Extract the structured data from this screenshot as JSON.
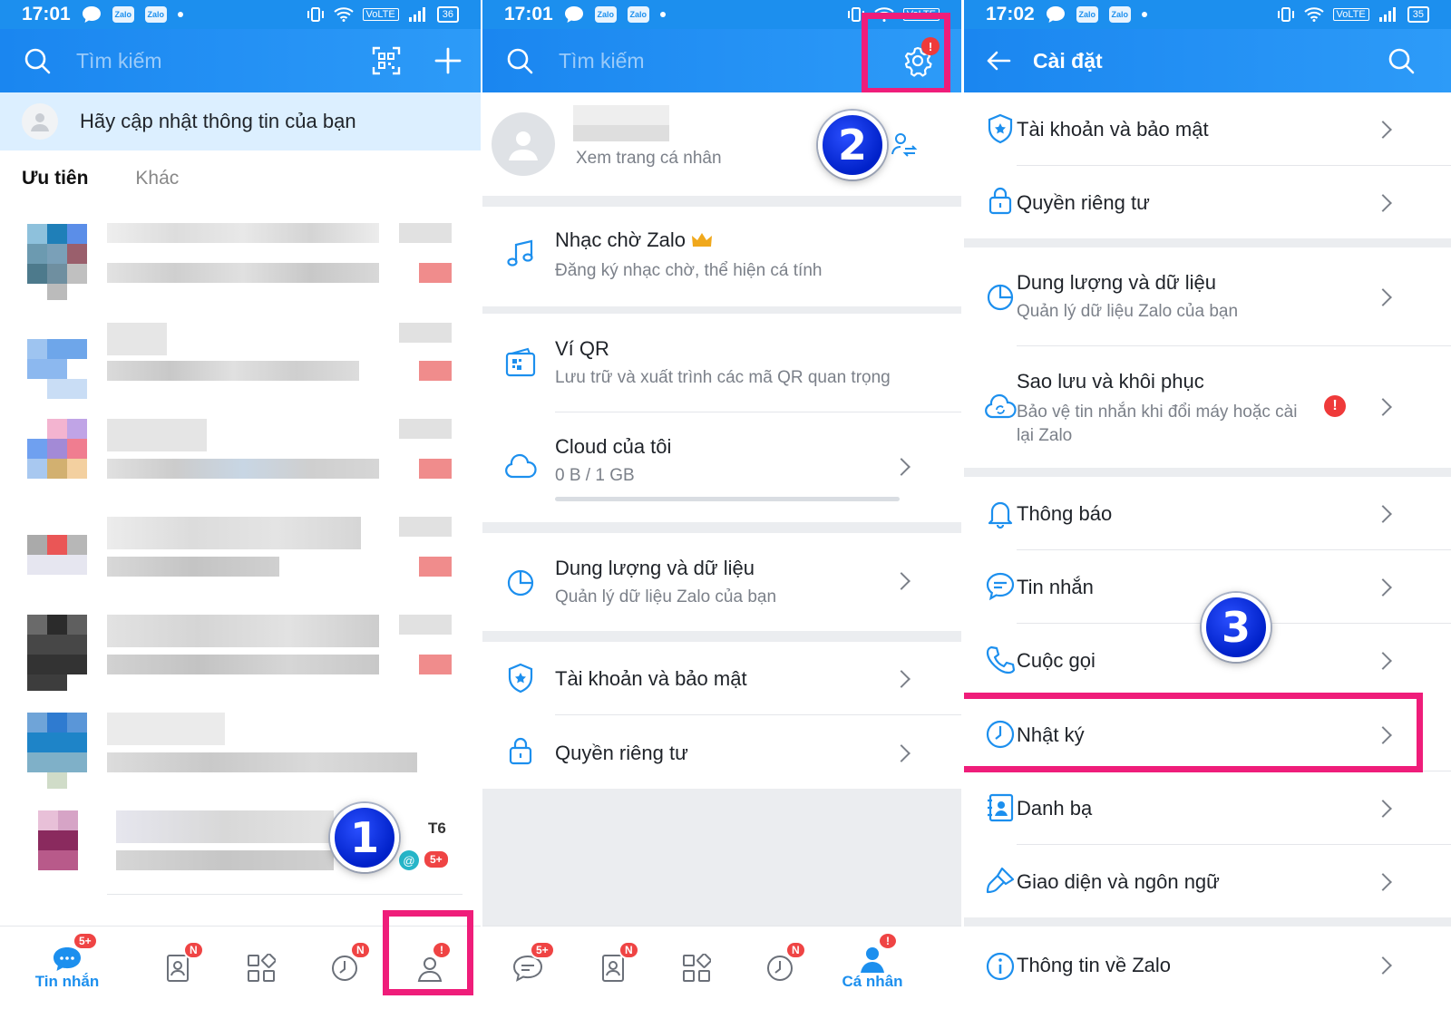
{
  "screen1": {
    "status": {
      "time": "17:01",
      "battery": "36"
    },
    "search_placeholder": "Tìm kiếm",
    "update_banner": "Hãy cập nhật thông tin của bạn",
    "tabs": [
      "Ưu tiên",
      "Khác"
    ],
    "last_chat_time": "T6",
    "last_chat_badge": "5+",
    "step_number": "1",
    "nav": {
      "messages_label": "Tin nhắn",
      "messages_badge": "5+",
      "contacts_badge": "N",
      "timeline_badge": "N",
      "profile_badge": "!"
    }
  },
  "screen2": {
    "status": {
      "time": "17:01"
    },
    "search_placeholder": "Tìm kiếm",
    "settings_badge": "!",
    "profile_link": "Xem trang cá nhân",
    "step_number": "2",
    "items": [
      {
        "title": "Nhạc chờ Zalo",
        "subtitle": "Đăng ký nhạc chờ, thể hiện cá tính"
      },
      {
        "title": "Ví QR",
        "subtitle": "Lưu trữ và xuất trình các mã QR quan trọng"
      },
      {
        "title": "Cloud của tôi",
        "subtitle": "0 B / 1 GB",
        "progress": 0.0
      },
      {
        "title": "Dung lượng và dữ liệu",
        "subtitle": "Quản lý dữ liệu Zalo của bạn"
      },
      {
        "title": "Tài khoản và bảo mật"
      },
      {
        "title": "Quyền riêng tư"
      }
    ],
    "nav": {
      "messages_badge": "5+",
      "contacts_badge": "N",
      "timeline_badge": "N",
      "profile_label": "Cá nhân",
      "profile_badge": "!"
    }
  },
  "screen3": {
    "status": {
      "time": "17:02",
      "battery": "35"
    },
    "title": "Cài đặt",
    "step_number": "3",
    "items": [
      {
        "title": "Tài khoản và bảo mật",
        "icon": "shield-icon"
      },
      {
        "title": "Quyền riêng tư",
        "icon": "lock-icon"
      },
      {
        "title": "Dung lượng và dữ liệu",
        "subtitle": "Quản lý dữ liệu Zalo của bạn",
        "icon": "pie-chart-icon"
      },
      {
        "title": "Sao lưu và khôi phục",
        "subtitle": "Bảo vệ tin nhắn khi đổi máy hoặc cài lại Zalo",
        "icon": "cloud-sync-icon",
        "alert": "!"
      },
      {
        "title": "Thông báo",
        "icon": "bell-icon"
      },
      {
        "title": "Tin nhắn",
        "icon": "chat-bubble-icon"
      },
      {
        "title": "Cuộc gọi",
        "icon": "phone-icon"
      },
      {
        "title": "Nhật ký",
        "icon": "clock-icon"
      },
      {
        "title": "Danh bạ",
        "icon": "contacts-book-icon"
      },
      {
        "title": "Giao diện và ngôn ngữ",
        "icon": "brush-icon"
      },
      {
        "title": "Thông tin về Zalo",
        "icon": "info-icon"
      }
    ]
  },
  "colors": {
    "accent": "#1c8fee",
    "highlight": "#ef1d7a",
    "badge": "#ef4444"
  }
}
